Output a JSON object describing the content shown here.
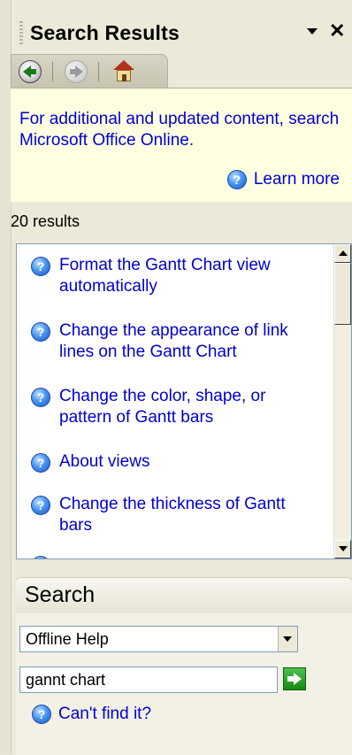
{
  "panel": {
    "title": "Search Results",
    "close_symbol": "✕"
  },
  "nav": {
    "back_icon": "back-arrow-icon",
    "forward_icon": "forward-arrow-icon",
    "home_icon": "home-icon"
  },
  "info": {
    "text": "For additional and updated content, search Microsoft Office Online.",
    "learn_more": "Learn more"
  },
  "results": {
    "count": "20 results",
    "items": [
      "Format the Gantt Chart view automatically",
      "Change the appearance of link lines on the Gantt Chart",
      "Change the color, shape, or pattern of Gantt bars",
      "About views",
      "Change the thickness of Gantt bars"
    ]
  },
  "search": {
    "title": "Search",
    "scope": "Offline Help",
    "query": "gannt chart",
    "cant_find": "Can't find it?"
  },
  "colors": {
    "link": "#0000d0",
    "info_bg": "#ffffe1",
    "panel_bg": "#ece9d8"
  }
}
